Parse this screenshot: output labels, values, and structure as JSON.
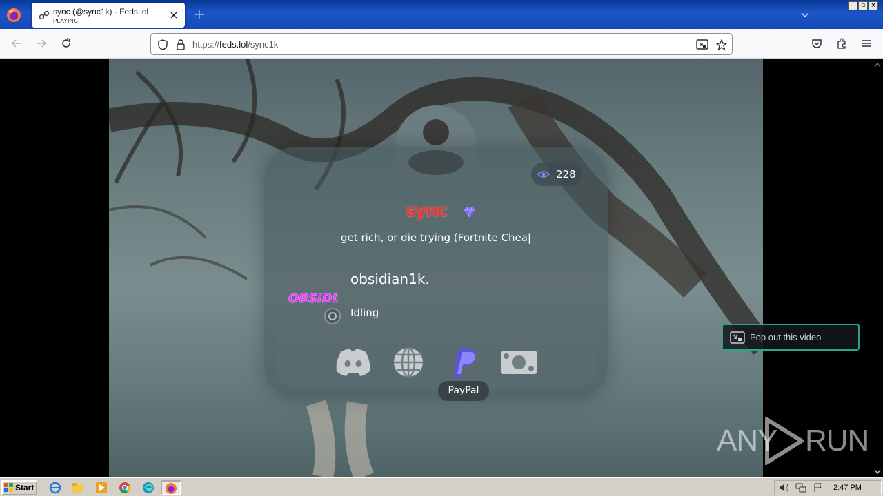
{
  "browser": {
    "tab": {
      "title": "sync (@sync1k) · Feds.lol",
      "subtitle": "PLAYING"
    },
    "url": {
      "protocol": "https://",
      "host": "feds.lol",
      "path": "/sync1k"
    }
  },
  "profile": {
    "views": "228",
    "username": "sync",
    "bio": "get rich, or die trying (Fortnite Chea|",
    "presence": {
      "avatar_text": "OBSIDIAN",
      "name": "obsidian1k.",
      "state": "Idling"
    },
    "socials": [
      {
        "name": "discord-icon"
      },
      {
        "name": "globe-icon"
      },
      {
        "name": "paypal-icon"
      },
      {
        "name": "cash-icon"
      }
    ],
    "tooltip": "PayPal"
  },
  "video": {
    "popout_label": "Pop out this video"
  },
  "watermark": {
    "left": "ANY",
    "right": "RUN"
  },
  "taskbar": {
    "start_label": "Start",
    "clock": "2:47 PM"
  },
  "colors": {
    "accent": "#2aa58c",
    "username": "#e53a3a",
    "paypal": "#7a73ff"
  }
}
